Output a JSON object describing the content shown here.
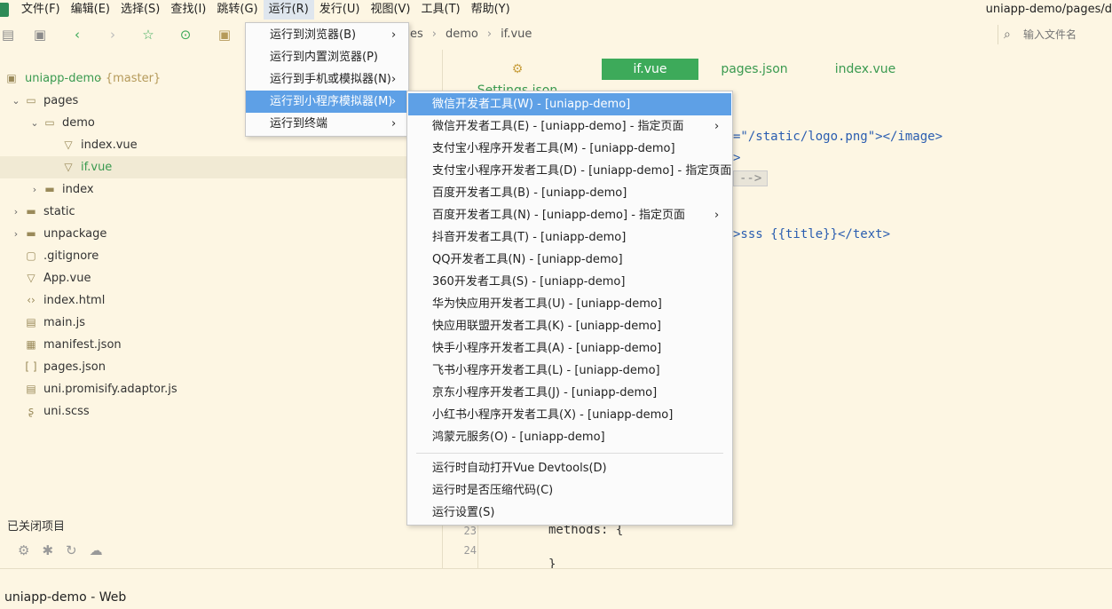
{
  "menubar": {
    "items": [
      "文件(F)",
      "编辑(E)",
      "选择(S)",
      "查找(I)",
      "跳转(G)",
      "运行(R)",
      "发行(U)",
      "视图(V)",
      "工具(T)",
      "帮助(Y)"
    ],
    "active": "运行(R)",
    "window_title": "uniapp-demo/pages/d"
  },
  "toolbar": {
    "icons": [
      "file-icon",
      "save-icon",
      "back-icon",
      "forward-icon",
      "star-icon",
      "run-icon",
      "project-icon"
    ],
    "breadcrumb": [
      "es",
      "demo",
      "if.vue"
    ],
    "file_search_placeholder": "输入文件名"
  },
  "sidebar": {
    "tree": [
      {
        "label": "uniapp-demo",
        "branch": " - {master}",
        "level": 0,
        "icon": "project-icon",
        "arrow": "",
        "color": "#3a9a50"
      },
      {
        "label": "pages",
        "level": 1,
        "icon": "folder-open-icon",
        "arrow": "⌄"
      },
      {
        "label": "demo",
        "level": 2,
        "icon": "folder-open-icon",
        "arrow": "⌄"
      },
      {
        "label": "index.vue",
        "level": 3,
        "icon": "vue-file-icon",
        "arrow": ""
      },
      {
        "label": "if.vue",
        "level": 3,
        "icon": "vue-file-icon",
        "arrow": "",
        "selected": true,
        "color": "#3a9a50"
      },
      {
        "label": "index",
        "level": 2,
        "icon": "folder-icon",
        "arrow": "›"
      },
      {
        "label": "static",
        "level": 1,
        "icon": "folder-icon",
        "arrow": "›"
      },
      {
        "label": "unpackage",
        "level": 1,
        "icon": "folder-icon",
        "arrow": "›"
      },
      {
        "label": ".gitignore",
        "level": 1,
        "icon": "file-icon",
        "arrow": ""
      },
      {
        "label": "App.vue",
        "level": 1,
        "icon": "vue-file-icon",
        "arrow": ""
      },
      {
        "label": "index.html",
        "level": 1,
        "icon": "html-file-icon",
        "arrow": ""
      },
      {
        "label": "main.js",
        "level": 1,
        "icon": "js-file-icon",
        "arrow": ""
      },
      {
        "label": "manifest.json",
        "level": 1,
        "icon": "manifest-icon",
        "arrow": ""
      },
      {
        "label": "pages.json",
        "level": 1,
        "icon": "json-file-icon",
        "arrow": ""
      },
      {
        "label": "uni.promisify.adaptor.js",
        "level": 1,
        "icon": "js-file-icon",
        "arrow": ""
      },
      {
        "label": "uni.scss",
        "level": 1,
        "icon": "scss-file-icon",
        "arrow": ""
      }
    ],
    "closed_projects_label": "已关闭项目",
    "bottom_icons": [
      "plugin-icon",
      "bug-icon",
      "refresh-icon",
      "cloud-icon"
    ]
  },
  "editor": {
    "tabs": [
      {
        "label": "Settings.json",
        "icon": "⚙",
        "active": false
      },
      {
        "label": "if.vue",
        "active": true
      },
      {
        "label": "pages.json",
        "active": false
      },
      {
        "label": "index.vue",
        "active": false
      }
    ],
    "code_fragments": {
      "line_a": "=\"/static/logo.png\"></image>",
      "line_b": ">",
      "line_c": "-->",
      "line_d": ">sss {{title}}</text>",
      "line_methods": "methods: {",
      "line_close": "}"
    },
    "line_numbers": [
      "23",
      "24"
    ]
  },
  "run_menu": {
    "items": [
      {
        "label": "运行到浏览器(B)",
        "has_submenu": true
      },
      {
        "label": "运行到内置浏览器(P)",
        "has_submenu": false
      },
      {
        "label": "运行到手机或模拟器(N)",
        "has_submenu": true
      },
      {
        "label": "运行到小程序模拟器(M)",
        "has_submenu": true,
        "highlighted": true
      },
      {
        "label": "运行到终端",
        "has_submenu": true
      }
    ]
  },
  "miniprogram_menu": {
    "items": [
      {
        "label": "微信开发者工具(W) - [uniapp-demo]",
        "has_submenu": false,
        "highlighted": true
      },
      {
        "label": "微信开发者工具(E) - [uniapp-demo] - 指定页面",
        "has_submenu": true
      },
      {
        "label": "支付宝小程序开发者工具(M) - [uniapp-demo]",
        "has_submenu": false
      },
      {
        "label": "支付宝小程序开发者工具(D) - [uniapp-demo] - 指定页面",
        "has_submenu": true
      },
      {
        "label": "百度开发者工具(B) - [uniapp-demo]",
        "has_submenu": false
      },
      {
        "label": "百度开发者工具(N) - [uniapp-demo] - 指定页面",
        "has_submenu": true
      },
      {
        "label": "抖音开发者工具(T) - [uniapp-demo]",
        "has_submenu": false
      },
      {
        "label": "QQ开发者工具(N) - [uniapp-demo]",
        "has_submenu": false
      },
      {
        "label": "360开发者工具(S) - [uniapp-demo]",
        "has_submenu": false
      },
      {
        "label": "华为快应用开发者工具(U) - [uniapp-demo]",
        "has_submenu": false
      },
      {
        "label": "快应用联盟开发者工具(K) - [uniapp-demo]",
        "has_submenu": false
      },
      {
        "label": "快手小程序开发者工具(A) - [uniapp-demo]",
        "has_submenu": false
      },
      {
        "label": "飞书小程序开发者工具(L) - [uniapp-demo]",
        "has_submenu": false
      },
      {
        "label": "京东小程序开发者工具(J) - [uniapp-demo]",
        "has_submenu": false
      },
      {
        "label": "小红书小程序开发者工具(X) - [uniapp-demo]",
        "has_submenu": false
      },
      {
        "label": "鸿蒙元服务(O) - [uniapp-demo]",
        "has_submenu": false
      }
    ],
    "footer_items": [
      {
        "label": "运行时自动打开Vue Devtools(D)"
      },
      {
        "label": "运行时是否压缩代码(C)"
      },
      {
        "label": "运行设置(S)"
      }
    ]
  },
  "statusbar": {
    "text": "uniapp-demo - Web"
  },
  "colors": {
    "accent_green": "#3daa5a",
    "menu_highlight": "#5ea0e6",
    "background": "#fdf6e3"
  }
}
